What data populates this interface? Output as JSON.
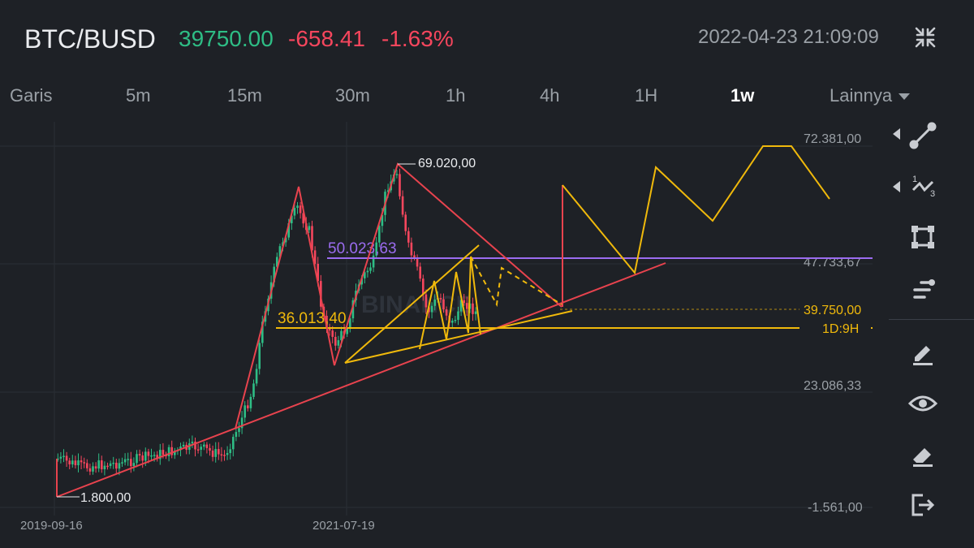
{
  "header": {
    "pair": "BTC/BUSD",
    "price": "39750.00",
    "change": "-658.41",
    "change_pct": "-1.63%",
    "timestamp": "2022-04-23 21:09:09",
    "collapse_icon": "collapse-arrows-icon"
  },
  "tabs": [
    {
      "label": "Garis",
      "active": false
    },
    {
      "label": "5m",
      "active": false
    },
    {
      "label": "15m",
      "active": false
    },
    {
      "label": "30m",
      "active": false
    },
    {
      "label": "1h",
      "active": false
    },
    {
      "label": "4h",
      "active": false
    },
    {
      "label": "1H",
      "active": false
    },
    {
      "label": "1w",
      "active": true
    },
    {
      "label": "Lainnya",
      "active": false,
      "caret": true
    }
  ],
  "chart": {
    "price_axis": [
      "72.381,00",
      "47.733,67",
      "23.086,33",
      "-1.561,00"
    ],
    "current_price_label": "39.750,00",
    "countdown_label": "1D:9H",
    "date_labels": [
      "2019-09-16",
      "2021-07-19"
    ],
    "annotations": {
      "high": "69.020,00",
      "low": "1.800,00",
      "purple_level": "50.023,63",
      "yellow_level": "36.013,40"
    },
    "watermark": "BINANCE",
    "colors": {
      "up": "#2ebd85",
      "down": "#f6465d",
      "red_line": "#e8434e",
      "yellow_line": "#f0b90b",
      "purple_line": "#9b6cf0",
      "axis_text": "#9aa0a6"
    }
  },
  "toolbar": {
    "tools": [
      "trend-line-icon",
      "fibonacci-icon",
      "rectangle-icon",
      "indicator-icon",
      "pencil-icon",
      "eye-icon",
      "eraser-icon",
      "exit-icon"
    ]
  }
}
